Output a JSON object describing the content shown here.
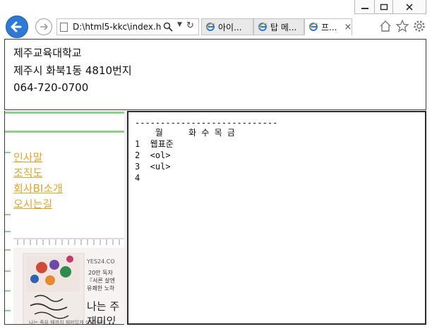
{
  "browser": {
    "address": "D:\\html5-kkc\\index.h",
    "tabs": [
      {
        "label": "아이..."
      },
      {
        "label": "탑 메..."
      },
      {
        "label": "프..."
      }
    ],
    "tab_close": "×"
  },
  "header": {
    "line1": "제주교육대학교",
    "line2": "제주시 화북1동 4810번지",
    "line3": "064-720-0700"
  },
  "menu": {
    "items": [
      {
        "label": "인사말"
      },
      {
        "label": "조직도"
      },
      {
        "label": "회사BI소개"
      },
      {
        "label": "오시는길"
      }
    ]
  },
  "ad": {
    "brand": "YES24.CO",
    "line1": "20만 독자",
    "line2": "『서른 살엔",
    "line3": "유쾌한 노하",
    "big1": "나는 주",
    "big2": "재미있",
    "book_title": "나는 죽을 때까지 재미있게 살고 싶다"
  },
  "content": {
    "rule": "----------------------------",
    "header_row": "    월     화 수 목 금",
    "rows": [
      "1  웹표준",
      "2  <ol>",
      "3  <ul>",
      "4"
    ]
  },
  "colors": {
    "link": "#e2a52a",
    "accent_green": "#8ed08e",
    "ie_blue": "#2d7ad6"
  }
}
